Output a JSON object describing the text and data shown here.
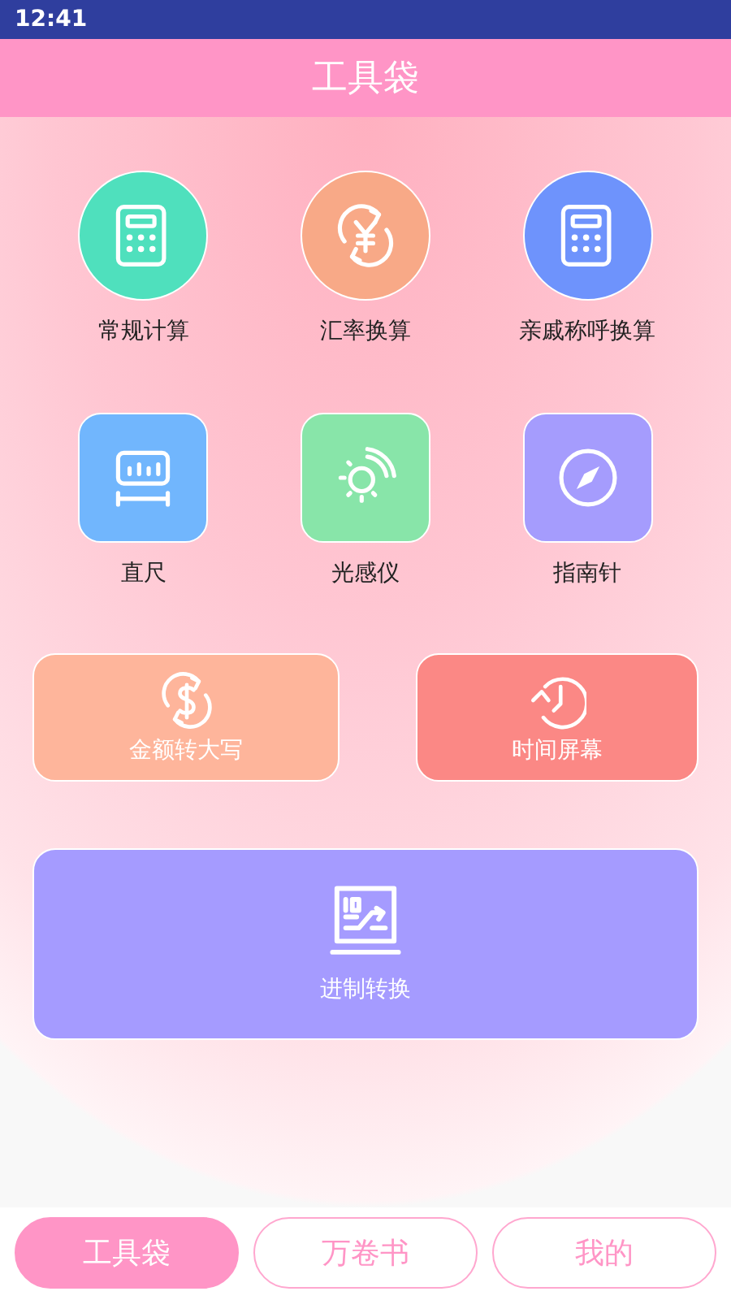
{
  "status_bar": {
    "time": "12:41"
  },
  "header": {
    "title": "工具袋"
  },
  "tools": [
    {
      "kind": "circle",
      "label": "常规计算",
      "color": "#4fe0bd"
    },
    {
      "kind": "circle",
      "label": "汇率换算",
      "color": "#f8a987"
    },
    {
      "kind": "circle",
      "label": "亲戚称呼换算",
      "color": "#6e93fc"
    },
    {
      "kind": "square",
      "label": "直尺",
      "color": "#71b6fd"
    },
    {
      "kind": "square",
      "label": "光感仪",
      "color": "#88e5a9"
    },
    {
      "kind": "square",
      "label": "指南针",
      "color": "#a59cfd"
    },
    {
      "kind": "wide",
      "label": "金额转大写",
      "color": "#feb59b"
    },
    {
      "kind": "wide",
      "label": "时间屏幕",
      "color": "#fb8885"
    },
    {
      "kind": "large",
      "label": "进制转换",
      "color": "#a59bff"
    }
  ],
  "tabs": [
    {
      "label": "工具袋",
      "selected": true
    },
    {
      "label": "万卷书",
      "selected": false
    },
    {
      "label": "我的",
      "selected": false
    }
  ]
}
